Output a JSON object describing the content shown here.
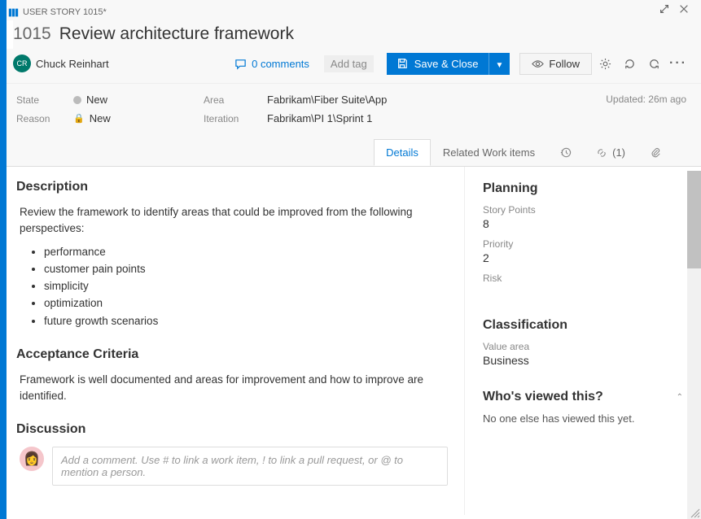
{
  "header": {
    "type_label": "USER STORY 1015*",
    "id": "1015",
    "title": "Review architecture framework"
  },
  "toolbar": {
    "assignee": "Chuck Reinhart",
    "assignee_initials": "CR",
    "comments_count": "0 comments",
    "add_tag": "Add tag",
    "save_close": "Save & Close",
    "follow": "Follow"
  },
  "fields": {
    "state_label": "State",
    "state_value": "New",
    "reason_label": "Reason",
    "reason_value": "New",
    "area_label": "Area",
    "area_value": "Fabrikam\\Fiber Suite\\App",
    "iteration_label": "Iteration",
    "iteration_value": "Fabrikam\\PI 1\\Sprint 1",
    "updated": "Updated: 26m ago"
  },
  "tabs": {
    "details": "Details",
    "related": "Related Work items",
    "links": "(1)"
  },
  "description": {
    "heading": "Description",
    "intro": "Review the framework to identify areas that could be improved from the following perspectives:",
    "b1": "performance",
    "b2": "customer pain points",
    "b3": "simplicity",
    "b4": "optimization",
    "b5": "future growth scenarios"
  },
  "acceptance": {
    "heading": "Acceptance Criteria",
    "text": "Framework is well documented and areas for improvement and how to improve are identified."
  },
  "discussion": {
    "heading": "Discussion",
    "placeholder": "Add a comment. Use # to link a work item, ! to link a pull request, or @ to mention a person."
  },
  "planning": {
    "heading": "Planning",
    "sp_label": "Story Points",
    "sp_value": "8",
    "pri_label": "Priority",
    "pri_value": "2",
    "risk_label": "Risk"
  },
  "classification": {
    "heading": "Classification",
    "va_label": "Value area",
    "va_value": "Business"
  },
  "viewed": {
    "heading": "Who's viewed this?",
    "text": "No one else has viewed this yet."
  }
}
